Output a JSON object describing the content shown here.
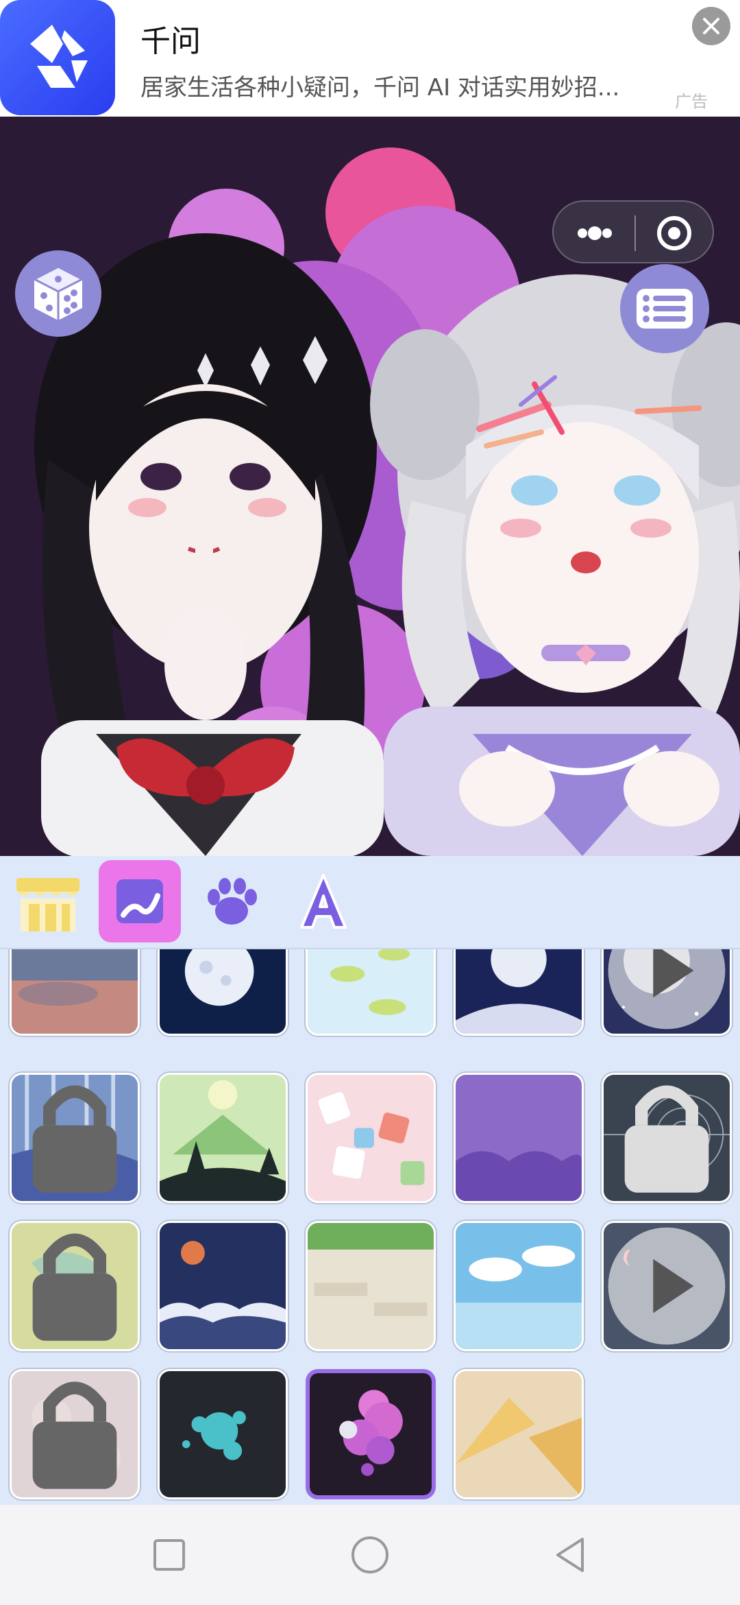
{
  "ad": {
    "title": "千问",
    "subtitle": "居家生活各种小疑问，千问 AI 对话实用妙招...",
    "tag": "广告",
    "icons": {
      "logo": "qianwen-logo",
      "close": "close-icon"
    }
  },
  "capsule": {
    "icons": [
      "more-dots-icon",
      "target-close-icon"
    ]
  },
  "stage": {
    "icons": [
      "dice-icon",
      "menu-list-icon",
      "trash-icon",
      "double-chevron-left-icon"
    ],
    "background_color": "#2b1a35"
  },
  "tabs": [
    {
      "name": "shop-tab",
      "icon": "storefront-icon",
      "active": false
    },
    {
      "name": "background-tab",
      "icon": "image-brush-icon",
      "active": true
    },
    {
      "name": "pet-tab",
      "icon": "paw-icon",
      "active": false
    },
    {
      "name": "text-tab",
      "icon": "letter-a-icon",
      "active": false
    }
  ],
  "backgrounds": [
    {
      "name": "sunset-clouds",
      "locked": false,
      "video": true,
      "selected": false
    },
    {
      "name": "full-moon-night",
      "locked": false,
      "video": false,
      "selected": false
    },
    {
      "name": "lily-pond",
      "locked": false,
      "video": false,
      "selected": false
    },
    {
      "name": "moon-over-lake",
      "locked": false,
      "video": false,
      "selected": false
    },
    {
      "name": "starry-moon",
      "locked": false,
      "video": true,
      "selected": false
    },
    {
      "name": "blue-forest-snow",
      "locked": true,
      "video": false,
      "selected": false
    },
    {
      "name": "green-mountain-pines",
      "locked": false,
      "video": false,
      "selected": false
    },
    {
      "name": "pink-stamps",
      "locked": false,
      "video": false,
      "selected": false
    },
    {
      "name": "purple-clouds-rays",
      "locked": false,
      "video": false,
      "selected": false
    },
    {
      "name": "spider-web",
      "locked": false,
      "video": true,
      "selected": false
    },
    {
      "name": "golden-koi-waves",
      "locked": true,
      "video": false,
      "selected": false
    },
    {
      "name": "red-sun-waves",
      "locked": false,
      "video": false,
      "selected": false
    },
    {
      "name": "ivy-stone-wall",
      "locked": false,
      "video": false,
      "selected": false
    },
    {
      "name": "sky-clouds",
      "locked": false,
      "video": false,
      "selected": false
    },
    {
      "name": "dusk-moon-sky",
      "locked": false,
      "video": true,
      "selected": false
    },
    {
      "name": "pink-pattern",
      "locked": true,
      "video": false,
      "selected": false
    },
    {
      "name": "teal-splatter",
      "locked": false,
      "video": false,
      "selected": false
    },
    {
      "name": "pink-bubbles",
      "locked": false,
      "video": false,
      "selected": true
    },
    {
      "name": "paper-fans",
      "locked": false,
      "video": false,
      "selected": false
    }
  ],
  "navbar": {
    "icons": [
      "recents-square-icon",
      "home-circle-icon",
      "back-triangle-icon"
    ]
  },
  "colors": {
    "accent": "#9a6de8",
    "panel": "#dde9fb",
    "tab_active": "#ea76ea",
    "button": "#8f8ad6"
  }
}
